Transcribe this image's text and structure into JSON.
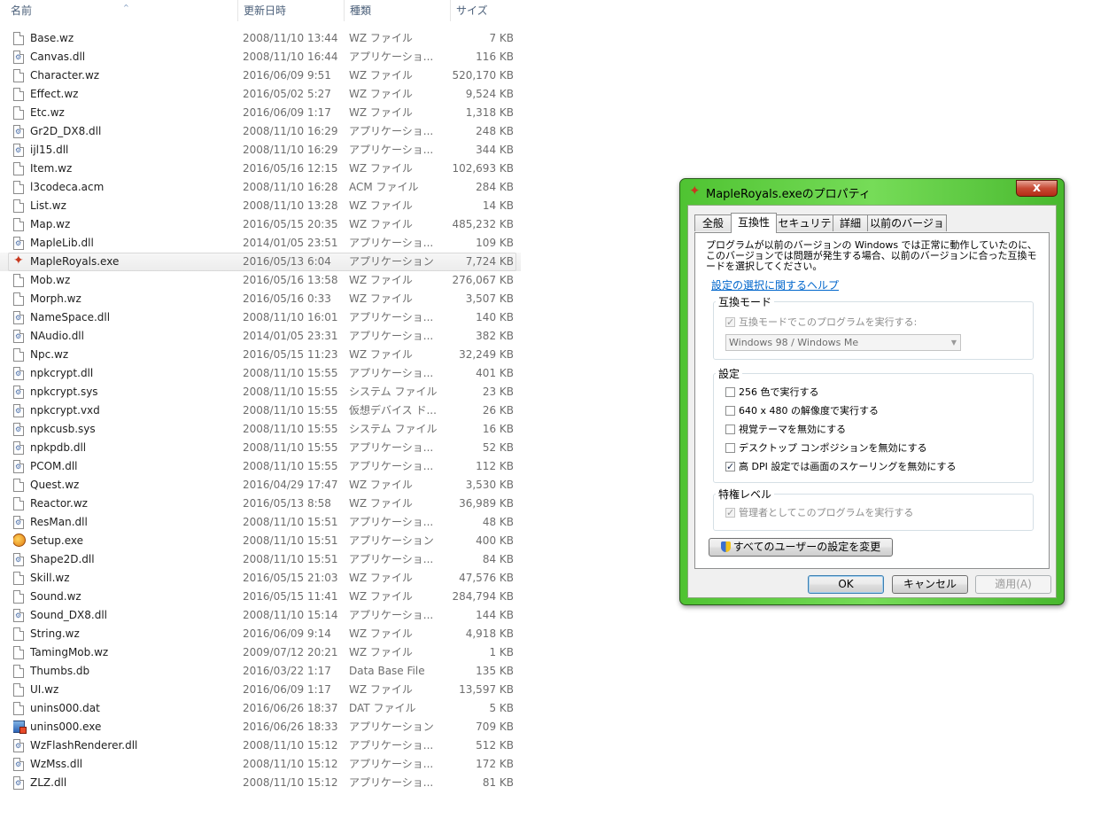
{
  "list": {
    "headers": {
      "name": "名前",
      "date": "更新日時",
      "type": "種類",
      "size": "サイズ"
    },
    "sort_icon": "sort-up-icon",
    "files": [
      {
        "name": "Base.wz",
        "date": "2008/11/10 13:44",
        "type": "WZ ファイル",
        "size": "7 KB",
        "icon": "file"
      },
      {
        "name": "Canvas.dll",
        "date": "2008/11/10 16:44",
        "type": "アプリケーショ...",
        "size": "116 KB",
        "icon": "dll"
      },
      {
        "name": "Character.wz",
        "date": "2016/06/09 9:51",
        "type": "WZ ファイル",
        "size": "520,170 KB",
        "icon": "file"
      },
      {
        "name": "Effect.wz",
        "date": "2016/05/02 5:27",
        "type": "WZ ファイル",
        "size": "9,524 KB",
        "icon": "file"
      },
      {
        "name": "Etc.wz",
        "date": "2016/06/09 1:17",
        "type": "WZ ファイル",
        "size": "1,318 KB",
        "icon": "file"
      },
      {
        "name": "Gr2D_DX8.dll",
        "date": "2008/11/10 16:29",
        "type": "アプリケーショ...",
        "size": "248 KB",
        "icon": "dll"
      },
      {
        "name": "ijl15.dll",
        "date": "2008/11/10 16:29",
        "type": "アプリケーショ...",
        "size": "344 KB",
        "icon": "dll"
      },
      {
        "name": "Item.wz",
        "date": "2016/05/16 12:15",
        "type": "WZ ファイル",
        "size": "102,693 KB",
        "icon": "file"
      },
      {
        "name": "l3codeca.acm",
        "date": "2008/11/10 16:28",
        "type": "ACM ファイル",
        "size": "284 KB",
        "icon": "file"
      },
      {
        "name": "List.wz",
        "date": "2008/11/10 13:28",
        "type": "WZ ファイル",
        "size": "14 KB",
        "icon": "file"
      },
      {
        "name": "Map.wz",
        "date": "2016/05/15 20:35",
        "type": "WZ ファイル",
        "size": "485,232 KB",
        "icon": "file"
      },
      {
        "name": "MapleLib.dll",
        "date": "2014/01/05 23:51",
        "type": "アプリケーショ...",
        "size": "109 KB",
        "icon": "dll"
      },
      {
        "name": "MapleRoyals.exe",
        "date": "2016/05/13 6:04",
        "type": "アプリケーション",
        "size": "7,724 KB",
        "icon": "maple",
        "selected": true
      },
      {
        "name": "Mob.wz",
        "date": "2016/05/16 13:58",
        "type": "WZ ファイル",
        "size": "276,067 KB",
        "icon": "file"
      },
      {
        "name": "Morph.wz",
        "date": "2016/05/16 0:33",
        "type": "WZ ファイル",
        "size": "3,507 KB",
        "icon": "file"
      },
      {
        "name": "NameSpace.dll",
        "date": "2008/11/10 16:01",
        "type": "アプリケーショ...",
        "size": "140 KB",
        "icon": "dll"
      },
      {
        "name": "NAudio.dll",
        "date": "2014/01/05 23:31",
        "type": "アプリケーショ...",
        "size": "382 KB",
        "icon": "dll"
      },
      {
        "name": "Npc.wz",
        "date": "2016/05/15 11:23",
        "type": "WZ ファイル",
        "size": "32,249 KB",
        "icon": "file"
      },
      {
        "name": "npkcrypt.dll",
        "date": "2008/11/10 15:55",
        "type": "アプリケーショ...",
        "size": "401 KB",
        "icon": "dll"
      },
      {
        "name": "npkcrypt.sys",
        "date": "2008/11/10 15:55",
        "type": "システム ファイル",
        "size": "23 KB",
        "icon": "dll"
      },
      {
        "name": "npkcrypt.vxd",
        "date": "2008/11/10 15:55",
        "type": "仮想デバイス ド...",
        "size": "26 KB",
        "icon": "dll"
      },
      {
        "name": "npkcusb.sys",
        "date": "2008/11/10 15:55",
        "type": "システム ファイル",
        "size": "16 KB",
        "icon": "dll"
      },
      {
        "name": "npkpdb.dll",
        "date": "2008/11/10 15:55",
        "type": "アプリケーショ...",
        "size": "52 KB",
        "icon": "dll"
      },
      {
        "name": "PCOM.dll",
        "date": "2008/11/10 15:55",
        "type": "アプリケーショ...",
        "size": "112 KB",
        "icon": "dll"
      },
      {
        "name": "Quest.wz",
        "date": "2016/04/29 17:47",
        "type": "WZ ファイル",
        "size": "3,530 KB",
        "icon": "file"
      },
      {
        "name": "Reactor.wz",
        "date": "2016/05/13 8:58",
        "type": "WZ ファイル",
        "size": "36,989 KB",
        "icon": "file"
      },
      {
        "name": "ResMan.dll",
        "date": "2008/11/10 15:51",
        "type": "アプリケーショ...",
        "size": "48 KB",
        "icon": "dll"
      },
      {
        "name": "Setup.exe",
        "date": "2008/11/10 15:51",
        "type": "アプリケーション",
        "size": "400 KB",
        "icon": "setup"
      },
      {
        "name": "Shape2D.dll",
        "date": "2008/11/10 15:51",
        "type": "アプリケーショ...",
        "size": "84 KB",
        "icon": "dll"
      },
      {
        "name": "Skill.wz",
        "date": "2016/05/15 21:03",
        "type": "WZ ファイル",
        "size": "47,576 KB",
        "icon": "file"
      },
      {
        "name": "Sound.wz",
        "date": "2016/05/15 11:41",
        "type": "WZ ファイル",
        "size": "284,794 KB",
        "icon": "file"
      },
      {
        "name": "Sound_DX8.dll",
        "date": "2008/11/10 15:14",
        "type": "アプリケーショ...",
        "size": "144 KB",
        "icon": "dll"
      },
      {
        "name": "String.wz",
        "date": "2016/06/09 9:14",
        "type": "WZ ファイル",
        "size": "4,918 KB",
        "icon": "file"
      },
      {
        "name": "TamingMob.wz",
        "date": "2009/07/12 20:21",
        "type": "WZ ファイル",
        "size": "1 KB",
        "icon": "file"
      },
      {
        "name": "Thumbs.db",
        "date": "2016/03/22 1:17",
        "type": "Data Base File",
        "size": "135 KB",
        "icon": "file"
      },
      {
        "name": "UI.wz",
        "date": "2016/06/09 1:17",
        "type": "WZ ファイル",
        "size": "13,597 KB",
        "icon": "file"
      },
      {
        "name": "unins000.dat",
        "date": "2016/06/26 18:37",
        "type": "DAT ファイル",
        "size": "5 KB",
        "icon": "file"
      },
      {
        "name": "unins000.exe",
        "date": "2016/06/26 18:33",
        "type": "アプリケーション",
        "size": "709 KB",
        "icon": "unins"
      },
      {
        "name": "WzFlashRenderer.dll",
        "date": "2008/11/10 15:12",
        "type": "アプリケーショ...",
        "size": "512 KB",
        "icon": "dll"
      },
      {
        "name": "WzMss.dll",
        "date": "2008/11/10 15:12",
        "type": "アプリケーショ...",
        "size": "172 KB",
        "icon": "dll"
      },
      {
        "name": "ZLZ.dll",
        "date": "2008/11/10 15:12",
        "type": "アプリケーショ...",
        "size": "81 KB",
        "icon": "dll"
      }
    ]
  },
  "dialog": {
    "title": "MapleRoyals.exeのプロパティ",
    "title_icon": "maple-leaf-icon",
    "close_label": "x",
    "tabs": [
      {
        "label": "全般"
      },
      {
        "label": "互換性",
        "active": true
      },
      {
        "label": "セキュリティ"
      },
      {
        "label": "詳細"
      },
      {
        "label": "以前のバージョン"
      }
    ],
    "intro": "プログラムが以前のバージョンの Windows では正常に動作していたのに、このバージョンでは問題が発生する場合、以前のバージョンに合った互換モードを選択してください。",
    "help_link": "設定の選択に関するヘルプ",
    "compat_group": {
      "label": "互換モード",
      "checkbox": {
        "label": "互換モードでこのプログラムを実行する:",
        "checked": true,
        "disabled": true
      },
      "combo_value": "Windows 98 / Windows Me"
    },
    "settings_group": {
      "label": "設定",
      "options": [
        {
          "label": "256 色で実行する",
          "checked": false
        },
        {
          "label": "640 x 480 の解像度で実行する",
          "checked": false
        },
        {
          "label": "視覚テーマを無効にする",
          "checked": false
        },
        {
          "label": "デスクトップ コンポジションを無効にする",
          "checked": false
        },
        {
          "label": "高 DPI 設定では画面のスケーリングを無効にする",
          "checked": true
        }
      ]
    },
    "privilege_group": {
      "label": "特権レベル",
      "checkbox": {
        "label": "管理者としてこのプログラムを実行する",
        "checked": true,
        "disabled": true
      }
    },
    "all_users_button": "すべてのユーザーの設定を変更",
    "ok_button": "OK",
    "cancel_button": "キャンセル",
    "apply_button": "適用(A)",
    "colors": {
      "frame_green": "#5fcf3f",
      "link": "#0066cc",
      "close_red": "#c74a34"
    }
  }
}
